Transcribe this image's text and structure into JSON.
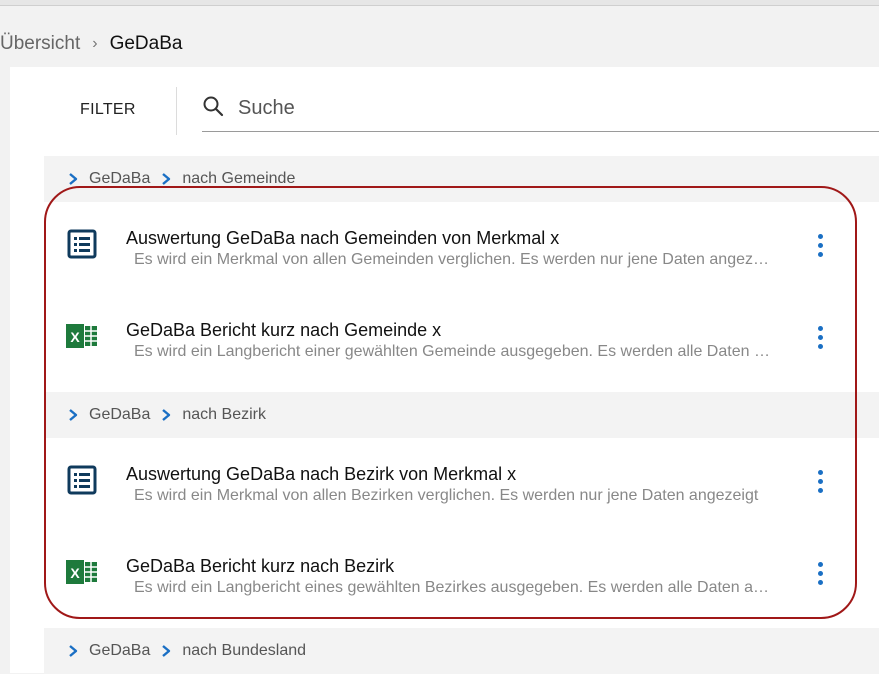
{
  "breadcrumb": {
    "root": "Übersicht",
    "separator": "›",
    "current": "GeDaBa"
  },
  "filter": {
    "label": "FILTER"
  },
  "search": {
    "placeholder": "Suche",
    "value": ""
  },
  "colors": {
    "accent": "#1a6fc4",
    "excel_green": "#1e7a3c",
    "report_icon": "#0f3a5c",
    "highlight": "#a01818"
  },
  "groups": [
    {
      "path": [
        "GeDaBa",
        "nach Gemeinde"
      ],
      "items": [
        {
          "icon": "report-list-icon",
          "title": "Auswertung GeDaBa nach Gemeinden von Merkmal x",
          "description": "Es wird ein Merkmal von allen Gemeinden verglichen. Es werden nur jene Daten angezeigt"
        },
        {
          "icon": "excel-icon",
          "title": "GeDaBa Bericht kurz nach Gemeinde x",
          "description": "Es wird ein Langbericht einer gewählten Gemeinde ausgegeben. Es werden alle Daten angezeigt"
        }
      ]
    },
    {
      "path": [
        "GeDaBa",
        "nach Bezirk"
      ],
      "items": [
        {
          "icon": "report-list-icon",
          "title": "Auswertung GeDaBa nach Bezirk von Merkmal x",
          "description": "Es wird ein Merkmal von allen Bezirken verglichen. Es werden nur jene Daten angezeigt"
        },
        {
          "icon": "excel-icon",
          "title": "GeDaBa Bericht kurz nach Bezirk",
          "description": "Es wird ein Langbericht eines gewählten Bezirkes ausgegeben. Es werden alle Daten angezeigt"
        }
      ]
    },
    {
      "path": [
        "GeDaBa",
        "nach Bundesland"
      ],
      "items": []
    }
  ]
}
